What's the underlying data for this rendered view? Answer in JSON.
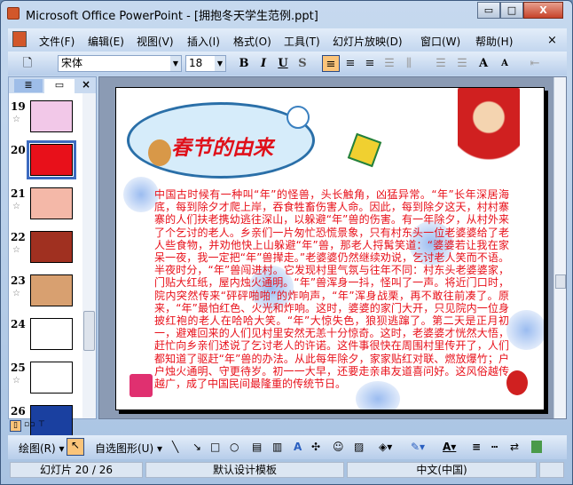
{
  "window": {
    "title": "Microsoft Office PowerPoint - [拥抱冬天学生范例.ppt]",
    "minimize": "▭",
    "maximize": "□",
    "close": "X"
  },
  "menu": [
    "文件(F)",
    "编辑(E)",
    "视图(V)",
    "插入(I)",
    "格式(O)",
    "工具(T)",
    "幻灯片放映(D)",
    "窗口(W)",
    "帮助(H)"
  ],
  "menu_close": "×",
  "toolbar": {
    "font": "宋体",
    "size": "18",
    "bold": "B",
    "italic": "I",
    "underline": "U",
    "shadow": "S",
    "align_left": "≡",
    "align_center": "≡",
    "align_right": "≡",
    "increase_font": "A",
    "decrease_font": "A"
  },
  "slides_pane": {
    "close": "×",
    "slides": [
      {
        "num": "19",
        "color": "#f2c8e8"
      },
      {
        "num": "20",
        "color": "#e8101a"
      },
      {
        "num": "21",
        "color": "#f4b8a8"
      },
      {
        "num": "22",
        "color": "#a03020"
      },
      {
        "num": "23",
        "color": "#d8a070"
      },
      {
        "num": "24",
        "color": "#ffffff"
      },
      {
        "num": "25",
        "color": "#ffffff"
      },
      {
        "num": "26",
        "color": "#1a40a0"
      }
    ],
    "selected": "20"
  },
  "slide": {
    "title": "春节的由来",
    "body": "中国古时候有一种叫“年”的怪兽，头长触角，凶猛异常。“年”长年深居海底，每到除夕才爬上岸，吞食牲畜伤害人命。因此，每到除夕这天，村村寨寨的人们扶老携幼逃往深山，以躲避“年”兽的伤害。有一年除夕，从村外来了个乞讨的老人。乡亲们一片匆忙恐慌景象，只有村东头一位老婆婆给了老人些食物，并劝他快上山躲避“年”兽，那老人捋髯笑道：“婆婆若让我在家呆一夜，我一定把“年”兽撵走。”老婆婆仍然继续劝说，乞讨老人笑而不语。 半夜时分，“年”兽闯进村。它发现村里气氛与往年不同：村东头老婆婆家，门贴大红纸，屋内烛火通明。“年”兽浑身一抖，怪叫了一声。将近门口时，院内突然传来“砰砰啪啪”的炸响声，“年”浑身战栗，再不敢往前凑了。原来，“年”最怕红色、火光和炸响。这时，婆婆的家门大开，只见院内一位身披红袍的老人在哈哈大笑。“年”大惊失色，狼狈逃蹿了。第二天是正月初一，避难回来的人们见村里安然无恙十分惊奇。这时，老婆婆才恍然大悟，赶忙向乡亲们述说了乞讨老人的许诺。这件事很快在周围村里传开了，人们都知道了驱赶“年”兽的办法。从此每年除夕，家家贴红对联、燃放爆竹；户户烛火通明、守更待岁。初一一大早，还要走亲串友道喜问好。这风俗越传越广，成了中国民间最隆重的传统节日。"
  },
  "drawing": {
    "draw": "绘图(R) ▾",
    "autoshapes": "自选图形(U) ▾"
  },
  "status": {
    "slide": "幻灯片 20 / 26",
    "template": "默认设计模板",
    "language": "中文(中国)"
  }
}
